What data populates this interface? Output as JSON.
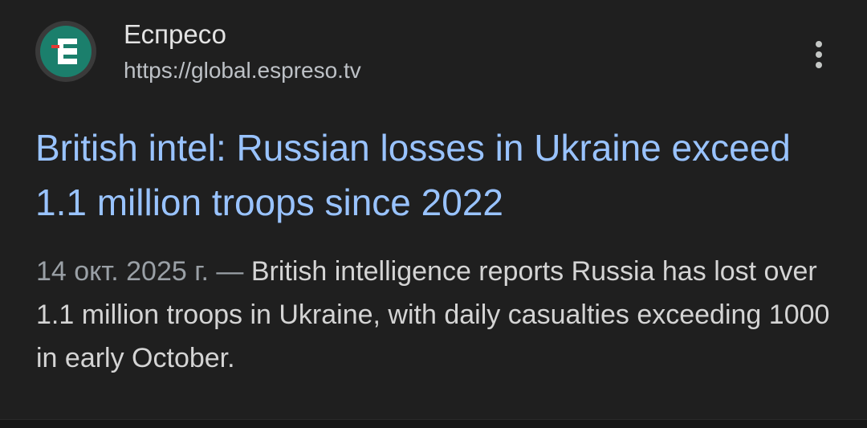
{
  "result": {
    "source": {
      "name": "Еспресо",
      "url": "https://global.espreso.tv",
      "favicon_icon": "espreso-logo-icon",
      "favicon_color": "#1b7f6c"
    },
    "menu_icon": "more-vert-icon",
    "headline": "British intel: Russian losses in Ukraine exceed 1.1 million troops since 2022",
    "date": "14 окт. 2025 г.",
    "separator": " — ",
    "snippet": "British intelligence reports Russia has lost over 1.1 million troops in Ukraine, with daily casualties exceeding 1000 in early October."
  },
  "colors": {
    "background": "#1f1f1f",
    "headline": "#99c3ff",
    "snippet": "#d4d4d4",
    "date": "#9aa0a6"
  }
}
